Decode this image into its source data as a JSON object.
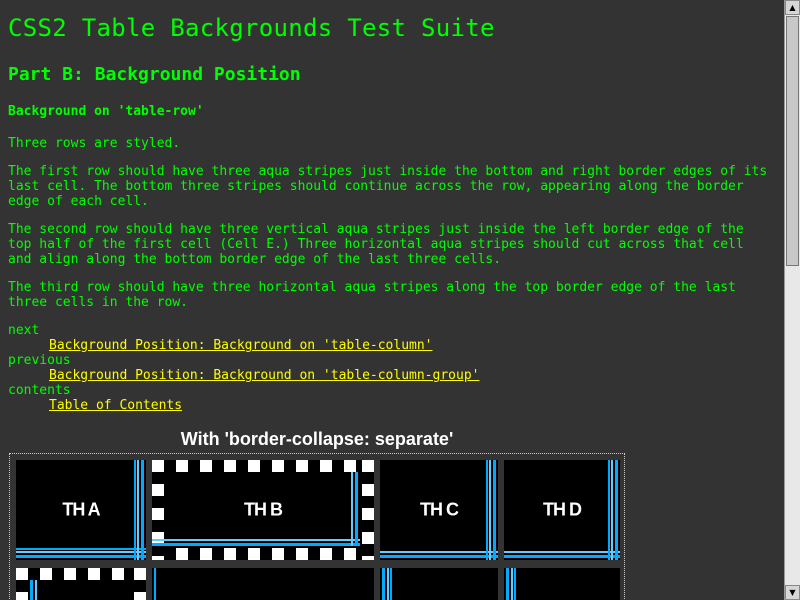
{
  "page": {
    "title": "CSS2 Table Backgrounds Test Suite",
    "subtitle": "Part B: Background Position",
    "section": "Background on 'table-row'",
    "paragraphs": [
      "Three rows are styled.",
      "The first row should have three aqua stripes just inside the bottom and right border edges of its last cell. The bottom three stripes should continue across the row, appearing along the border edge of each cell.",
      "The second row should have three vertical aqua stripes just inside the left border edge of the top half of the first cell (Cell E.) Three horizontal aqua stripes should cut across that cell and align along the bottom border edge of the last three cells.",
      "The third row should have three horizontal aqua stripes along the top border edge of the last three cells in the row."
    ]
  },
  "nav": {
    "next_label": "next",
    "next_link": "Background Position: Background on 'table-column'",
    "previous_label": "previous",
    "previous_link": "Background Position: Background on 'table-column-group'",
    "contents_label": "contents",
    "contents_link": "Table of Contents"
  },
  "table": {
    "caption": "With 'border-collapse: separate'",
    "headers": [
      "TH A",
      "TH B",
      "TH C",
      "TH D"
    ]
  },
  "colors": {
    "background": "#333333",
    "text": "#00ff00",
    "link": "#ffff00",
    "stripe": "#00aaff",
    "cell": "#000000"
  }
}
